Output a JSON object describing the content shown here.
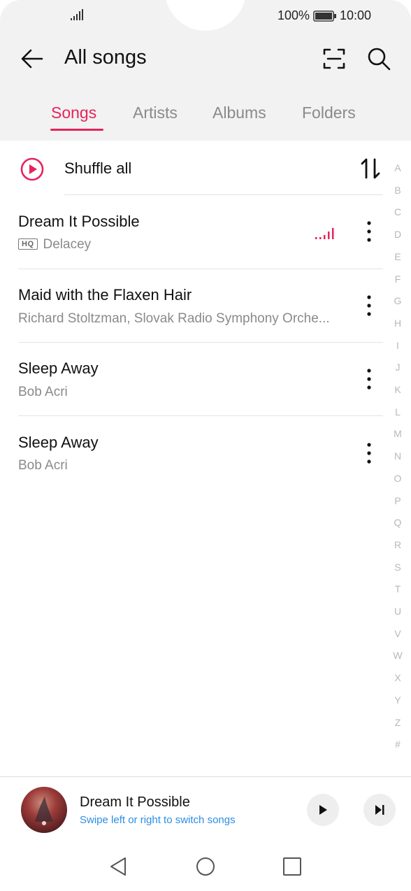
{
  "status_bar": {
    "battery": "100%",
    "time": "10:00",
    "icons": [
      "signal-icon",
      "battery-icon"
    ]
  },
  "header": {
    "title": "All songs",
    "icons": [
      "back-arrow-icon",
      "scan-icon",
      "search-icon"
    ]
  },
  "tabs": [
    {
      "label": "Songs",
      "active": true
    },
    {
      "label": "Artists",
      "active": false
    },
    {
      "label": "Albums",
      "active": false
    },
    {
      "label": "Folders",
      "active": false
    }
  ],
  "shuffle": {
    "label": "Shuffle all",
    "icons": [
      "play-circle-icon",
      "sort-icon"
    ]
  },
  "songs": [
    {
      "title": "Dream It Possible",
      "artist": "Delacey",
      "badge": "HQ",
      "playing": true
    },
    {
      "title": "Maid with the Flaxen Hair",
      "artist": "Richard Stoltzman, Slovak Radio Symphony Orche...",
      "badge": "",
      "playing": false
    },
    {
      "title": "Sleep Away",
      "artist": "Bob Acri",
      "badge": "",
      "playing": false
    },
    {
      "title": "Sleep Away",
      "artist": "Bob Acri",
      "badge": "",
      "playing": false
    }
  ],
  "alphabet_index": [
    "A",
    "B",
    "C",
    "D",
    "E",
    "F",
    "G",
    "H",
    "I",
    "J",
    "K",
    "L",
    "M",
    "N",
    "O",
    "P",
    "Q",
    "R",
    "S",
    "T",
    "U",
    "V",
    "W",
    "X",
    "Y",
    "Z",
    "#"
  ],
  "now_playing": {
    "title": "Dream It Possible",
    "hint": "Swipe left or right to switch songs",
    "icons": [
      "play-icon",
      "next-track-icon"
    ]
  },
  "nav_bar": {
    "icons": [
      "nav-back-icon",
      "nav-home-icon",
      "nav-recents-icon"
    ]
  },
  "colors": {
    "accent": "#e5245c",
    "hint_blue": "#2b8ee6",
    "header_bg": "#f2f2f2",
    "muted_text": "#8a8a8a"
  }
}
